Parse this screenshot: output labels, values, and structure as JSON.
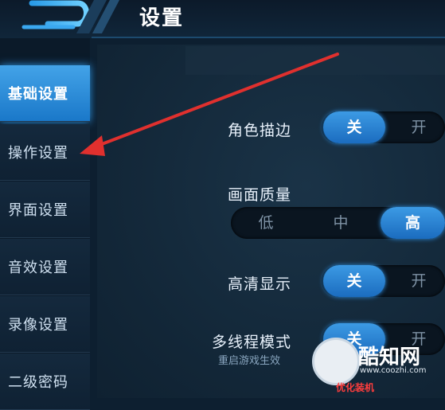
{
  "header": {
    "title": "设置"
  },
  "sidebar": {
    "items": [
      {
        "label": "基础设置",
        "active": true
      },
      {
        "label": "操作设置",
        "active": false
      },
      {
        "label": "界面设置",
        "active": false
      },
      {
        "label": "音效设置",
        "active": false
      },
      {
        "label": "录像设置",
        "active": false
      },
      {
        "label": "二级密码",
        "active": false
      }
    ]
  },
  "settings": {
    "outline": {
      "label": "角色描边",
      "options": [
        "关",
        "开"
      ],
      "selected": "关"
    },
    "quality": {
      "label": "画面质量",
      "options": [
        "低",
        "中",
        "高"
      ],
      "selected": "高"
    },
    "hd": {
      "label": "高清显示",
      "options": [
        "关",
        "开"
      ],
      "selected": "关"
    },
    "multithread": {
      "label": "多线程模式",
      "sublabel": "重启游戏生效",
      "options": [
        "关",
        "开"
      ],
      "selected": "关"
    }
  },
  "watermark": {
    "brand": "酷知网",
    "url": "www.coozhi.com",
    "bottom": "优化装机"
  },
  "colors": {
    "accent": "#2d8fe0",
    "arrow": "#e0302e"
  }
}
